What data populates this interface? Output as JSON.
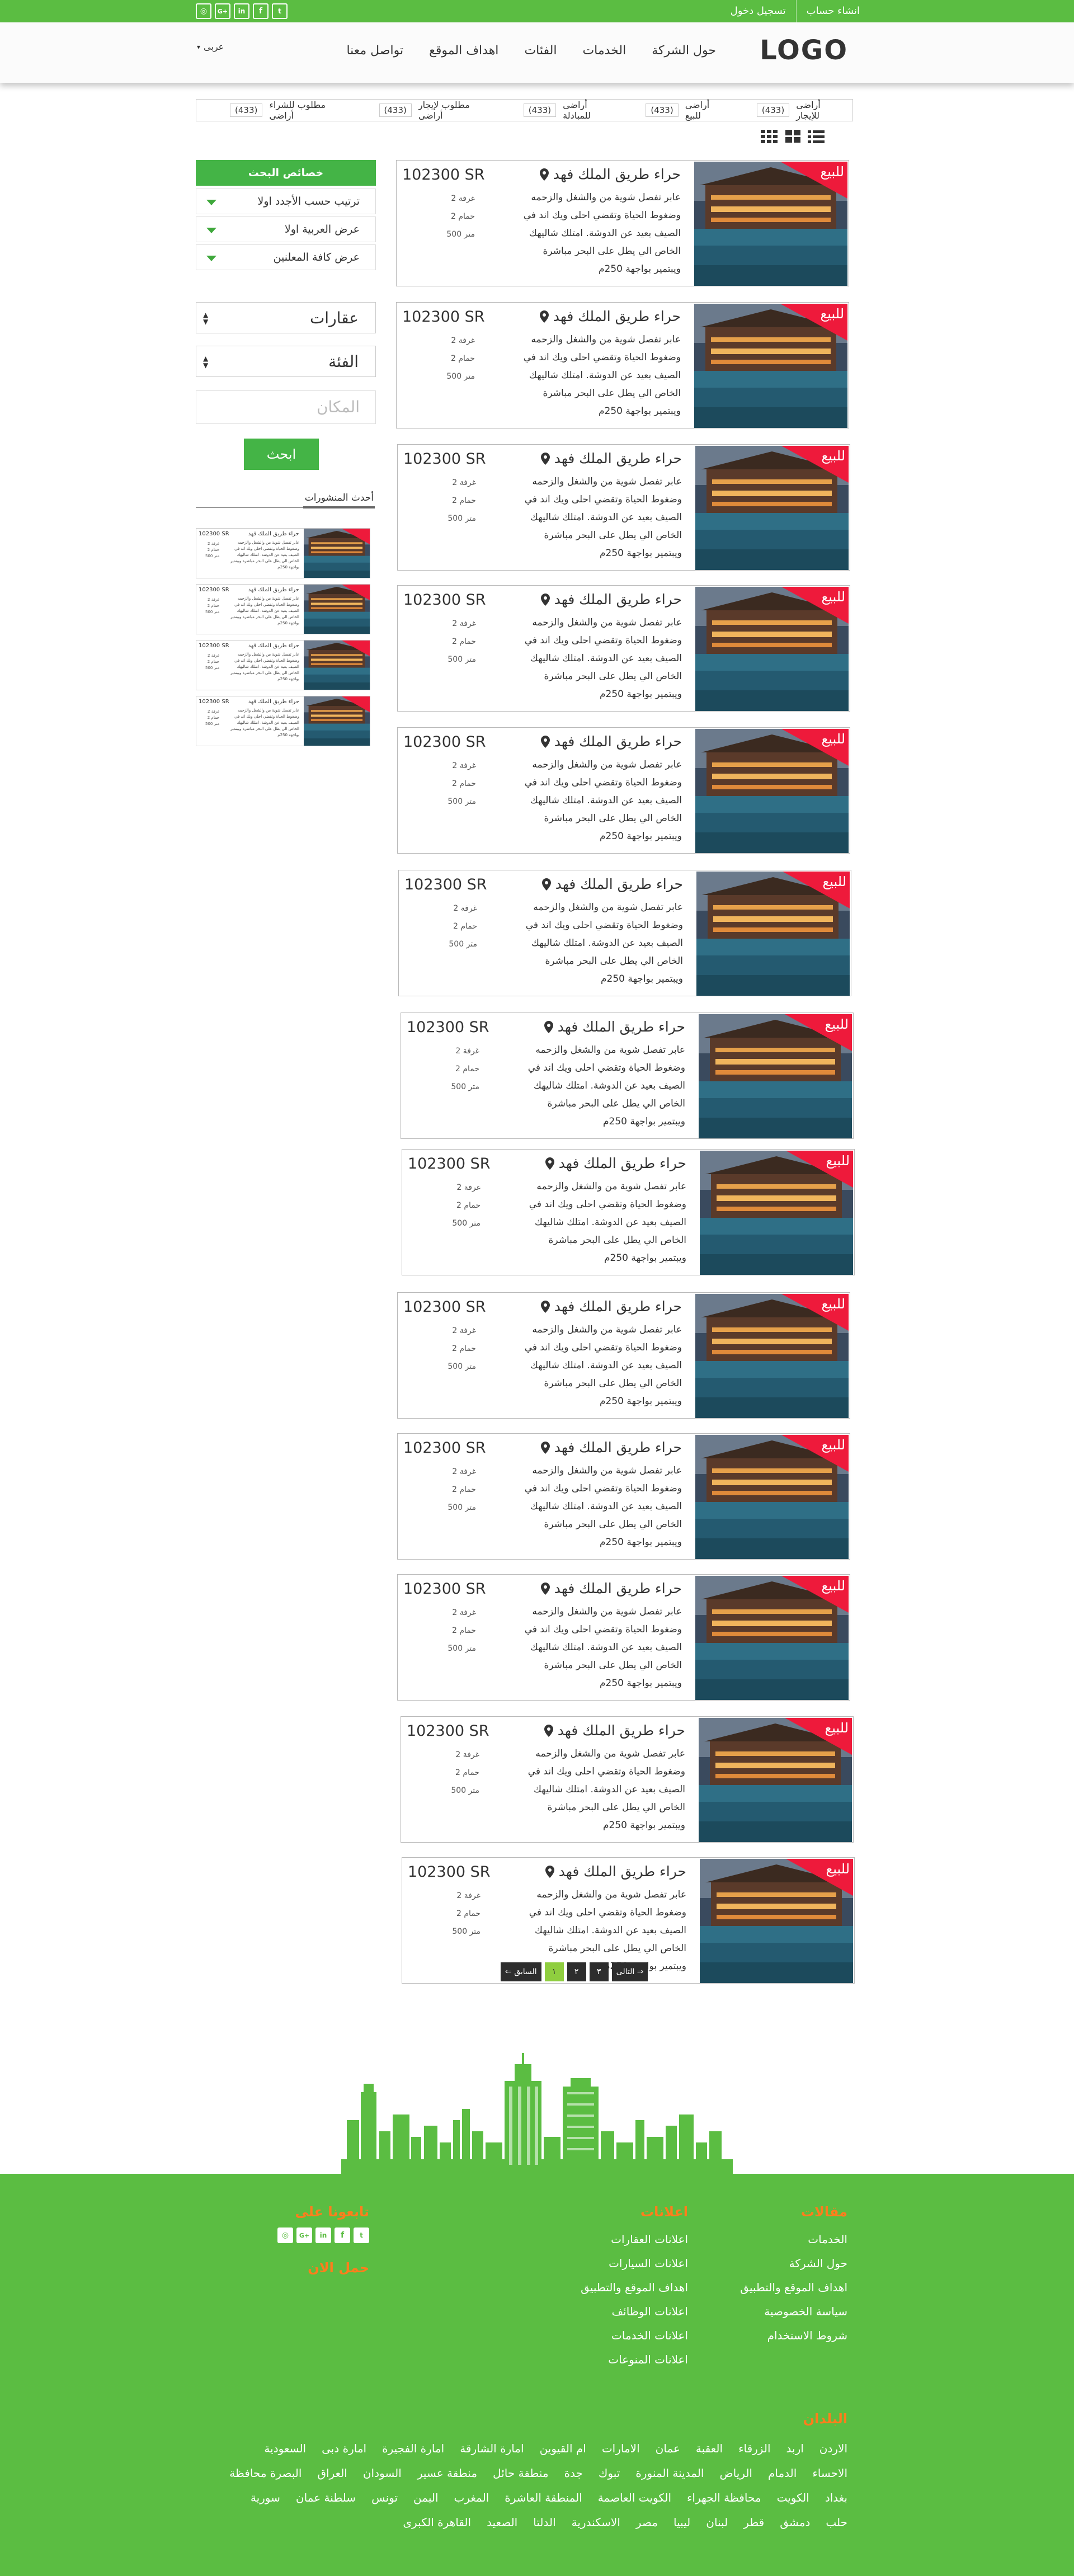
{
  "topbar": {
    "auth": [
      "تسجيل دخول",
      "انشاء حساب"
    ],
    "social_icons": [
      "twitter-icon",
      "facebook-icon",
      "linkedin-icon",
      "google-plus-icon",
      "instagram-icon"
    ]
  },
  "header": {
    "logo": "LOGO",
    "nav": [
      "حول الشركة",
      "الخدمات",
      "الفئات",
      "اهداف الموقع",
      "تواصل معنا"
    ],
    "language": "عربى"
  },
  "categories": [
    {
      "label": "أراضى للإيجار",
      "count": "(433)"
    },
    {
      "label": "أراضى للبيع",
      "count": "(433)"
    },
    {
      "label": "أراضى للمبادلة",
      "count": "(433)"
    },
    {
      "label": "مطلوب لإيجار أراضى",
      "count": "(433)"
    },
    {
      "label": "مطلوب للشراء أراضى",
      "count": "(433)"
    }
  ],
  "sidebar": {
    "title": "خصائص البحث",
    "sort_options": [
      "ترتيب حسب الأجدد اولا",
      "عرض العربية اولا",
      "عرض كافة المعلنين"
    ],
    "select_property": "عقارات",
    "select_category": "الفئة",
    "location_placeholder": "المكان",
    "search_button": "ابحث",
    "latest_title": "أحدث المنشورات"
  },
  "listings": [
    {
      "title": "حراء طريق الملك فهد",
      "price": "102300 SR",
      "badge": "للبيع",
      "description": "عابر تفصل شوية من والشغل والزحمه وضغوط الحياة وتقضي احلى ويك اند في الصيف بعيد عن الدوشة. امتلك شاليهك الخاص الي يطل على البحر مباشرة ويبتمير بواجهة 250م",
      "specs": [
        "2 غرفة",
        "2 حمام",
        "500 متر"
      ]
    }
  ],
  "pagination": {
    "next": "التالى",
    "pages": [
      "٣",
      "٢",
      "١"
    ],
    "prev": "السابق"
  },
  "footer": {
    "col1": {
      "title": "مقالات",
      "links": [
        "الخدمات",
        "حول الشركة",
        "اهداف الموقع والتطبيق",
        "سياسة الخصوصية",
        "شروط الاستخدام"
      ]
    },
    "col2": {
      "title": "اعلانات",
      "links": [
        "اعلانات العقارات",
        "اعلانات السيارات",
        "اهداف الموقع والتطبيق",
        "اعلانات الوظائف",
        "اعلانات الخدمات",
        "اعلانات المنوعات"
      ]
    },
    "col3": {
      "title": "تابعونا على",
      "download": "حمل الان"
    },
    "countries_title": "البلدان",
    "countries": [
      "الاردن",
      "اربد",
      "الزرقاء",
      "العقبة",
      "عمان",
      "الامارات",
      "ام القيوين",
      "امارة الشارقة",
      "امارة الفجيرة",
      "امارة دبى",
      "السعودية",
      "الاحساء",
      "الدمام",
      "الرياض",
      "المدينة المنورة",
      "تبوك",
      "جدة",
      "منطقة حائل",
      "منطقة عسير",
      "السودان",
      "العراق",
      "البصرة محافظة",
      "بغداد",
      "الكويت",
      "محافظة الجهراء",
      "الكويت العاصمة",
      "المنطقة العاشرة",
      "المغرب",
      "اليمن",
      "تونس",
      "سلطنة عمان",
      "سورية",
      "حلب",
      "دمشق",
      "قطر",
      "لبنان",
      "ليبيا",
      "مصر",
      "الاسكندرية",
      "الدلتا",
      "الصعيد",
      "القاهرة الكبرى"
    ]
  },
  "colors": {
    "brand_green": "#5bbd42",
    "button_green": "#44b446",
    "badge_red": "#ee1a3b",
    "footer_heading": "#ff7d1c"
  }
}
